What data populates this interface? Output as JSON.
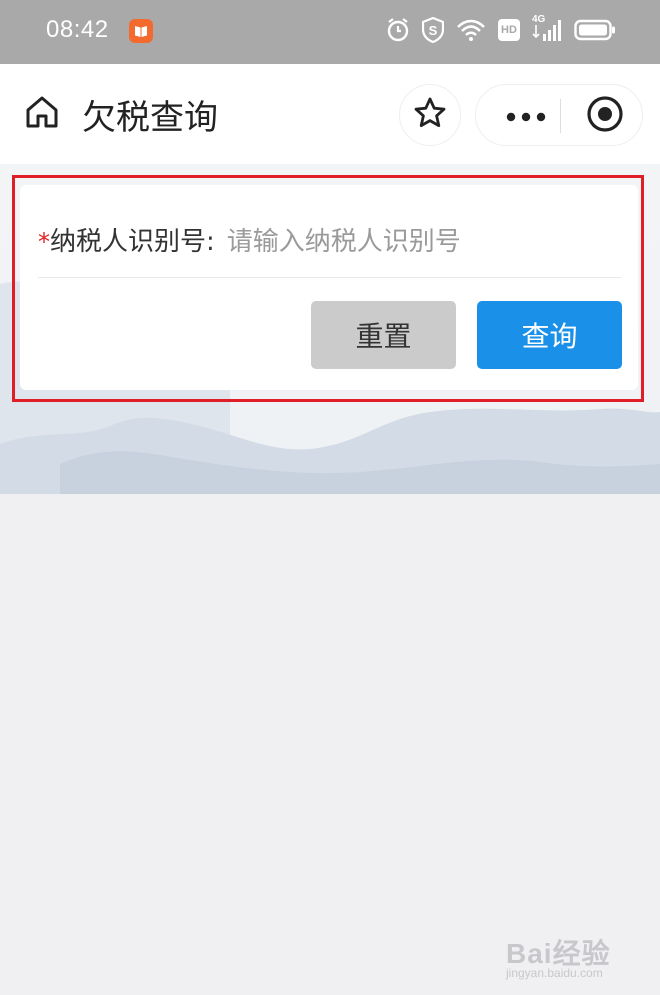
{
  "status_bar": {
    "time": "08:42",
    "icons": [
      "app-book-icon",
      "alarm-icon",
      "shield-s-icon",
      "wifi-icon",
      "hd-icon",
      "signal-4g-icon",
      "battery-icon"
    ],
    "hd_label": "HD",
    "network_label": "4G"
  },
  "nav": {
    "title": "欠税查询",
    "icons": [
      "home-icon",
      "star-icon",
      "more-icon",
      "close-mini-program-icon"
    ]
  },
  "form": {
    "required_mark": "*",
    "field_label": "纳税人识别号:",
    "field_placeholder": "请输入纳税人识别号",
    "field_value": "",
    "reset_label": "重置",
    "query_label": "查询"
  },
  "watermark": {
    "brand": "Bai经验",
    "url": "jingyan.baidu.com"
  },
  "colors": {
    "status_bar_bg": "#a9a9a9",
    "primary": "#1a90e8",
    "reset_bg": "#cbcbcb",
    "required": "#e02020",
    "highlight": "#e01e27",
    "page_bg": "#f0f0f2"
  }
}
